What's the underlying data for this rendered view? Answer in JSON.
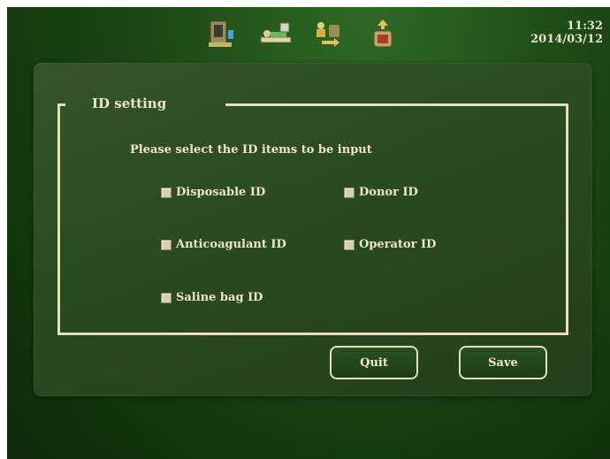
{
  "header": {
    "icons": [
      "tubing-set-icon",
      "patient-bed-icon",
      "donor-transfer-icon",
      "bag-upload-icon"
    ],
    "time": "11:32",
    "date": "2014/03/12"
  },
  "panel": {
    "title": "ID setting",
    "prompt": "Please select the ID items to be input",
    "options": [
      {
        "label": "Disposable ID"
      },
      {
        "label": "Donor ID"
      },
      {
        "label": "Anticoagulant ID"
      },
      {
        "label": "Operator ID"
      },
      {
        "label": "Saline bag ID"
      }
    ]
  },
  "buttons": {
    "quit": "Quit",
    "save": "Save"
  },
  "colors": {
    "background": "#1b4714",
    "panel": "#2a4a22",
    "accent_text": "#ede7c9"
  }
}
